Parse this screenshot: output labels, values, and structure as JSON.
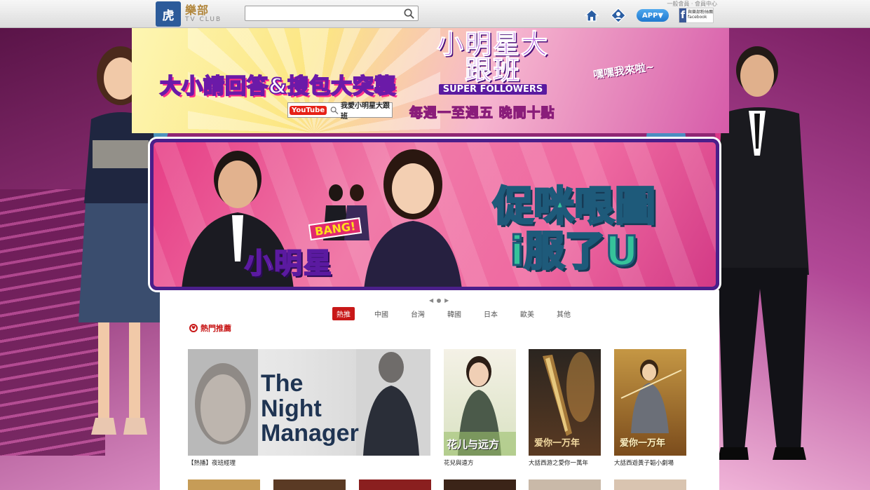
{
  "header": {
    "logo_mark": "虎",
    "logo_name": "樂部",
    "logo_sub": "TV CLUB",
    "search_placeholder": "",
    "top_note": "一般會員 · 會員中心",
    "app_label": "APP▼",
    "fb_text": "與樂部粉絲團 facebook"
  },
  "hero": {
    "tagline": "大小請回答&搜包大突襲",
    "youtube_label": "YouTube",
    "youtube_search": "我愛小明星大跟班",
    "show_logo": "小明星大跟班",
    "show_logo_sub": "SUPER FOLLOWERS",
    "schedule": "每週一至週五 晚間十點",
    "callout": "嘿嘿我來啦~"
  },
  "banner": {
    "bang": "BANG!",
    "show_logo": "小明星",
    "title_line1": "促咪哏圖",
    "title_line2": "i服了U"
  },
  "tabs": [
    {
      "label": "熱推",
      "active": true
    },
    {
      "label": "中國",
      "active": false
    },
    {
      "label": "台灣",
      "active": false
    },
    {
      "label": "韓國",
      "active": false
    },
    {
      "label": "日本",
      "active": false
    },
    {
      "label": "歐美",
      "active": false
    },
    {
      "label": "其他",
      "active": false
    }
  ],
  "section": {
    "title": "熱門推薦"
  },
  "cards": [
    {
      "caption": "【熱播】夜班經理",
      "poster_text": "The Night Manager"
    },
    {
      "caption": "花兒與遠方",
      "poster_text": "花儿与远方"
    },
    {
      "caption": "大話西游之愛你一萬年",
      "poster_text": "爱你一万年"
    },
    {
      "caption": "大話西遊黃子韜小劇場",
      "poster_text": "爱你一万年"
    }
  ],
  "colors": {
    "accent_red": "#c81818",
    "brand_blue": "#2c5b9a",
    "banner_border": "#4a1f8a"
  }
}
